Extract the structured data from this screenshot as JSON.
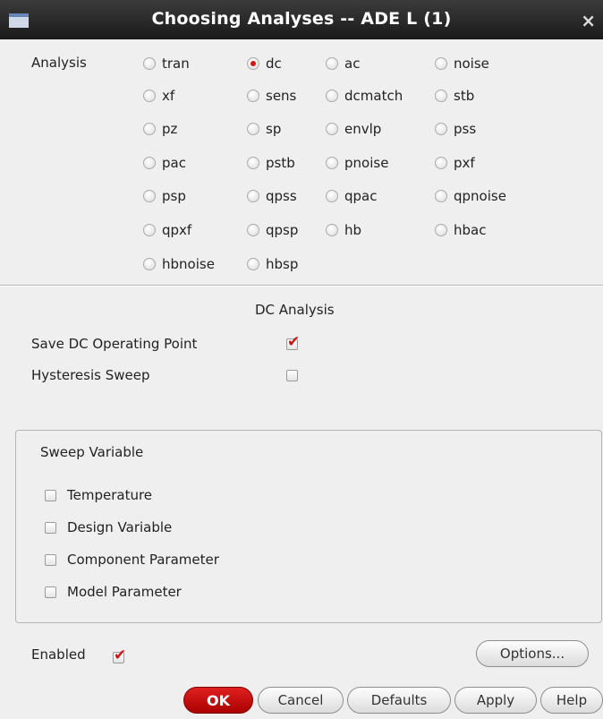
{
  "window": {
    "title": "Choosing Analyses -- ADE L (1)",
    "close_symbol": "×"
  },
  "analysis": {
    "label": "Analysis",
    "selected": "dc",
    "options": [
      "tran",
      "dc",
      "ac",
      "noise",
      "xf",
      "sens",
      "dcmatch",
      "stb",
      "pz",
      "sp",
      "envlp",
      "pss",
      "pac",
      "pstb",
      "pnoise",
      "pxf",
      "psp",
      "qpss",
      "qpac",
      "qpnoise",
      "qpxf",
      "qpsp",
      "hb",
      "hbac",
      "hbnoise",
      "hbsp"
    ]
  },
  "dc_analysis": {
    "heading": "DC Analysis",
    "save_dc_op_label": "Save DC Operating Point",
    "save_dc_op_checked": true,
    "hysteresis_label": "Hysteresis Sweep",
    "hysteresis_checked": false
  },
  "sweep": {
    "heading": "Sweep Variable",
    "items": [
      {
        "label": "Temperature",
        "checked": false
      },
      {
        "label": "Design Variable",
        "checked": false
      },
      {
        "label": "Component Parameter",
        "checked": false
      },
      {
        "label": "Model Parameter",
        "checked": false
      }
    ]
  },
  "footer": {
    "enabled_label": "Enabled",
    "enabled_checked": true,
    "options_label": "Options...",
    "buttons": {
      "ok": "OK",
      "cancel": "Cancel",
      "defaults": "Defaults",
      "apply": "Apply",
      "help": "Help"
    }
  },
  "colors": {
    "accent_red": "#d01818",
    "titlebar": "#1f1f1f",
    "background": "#efefef"
  },
  "icons": {
    "check": "✔"
  }
}
